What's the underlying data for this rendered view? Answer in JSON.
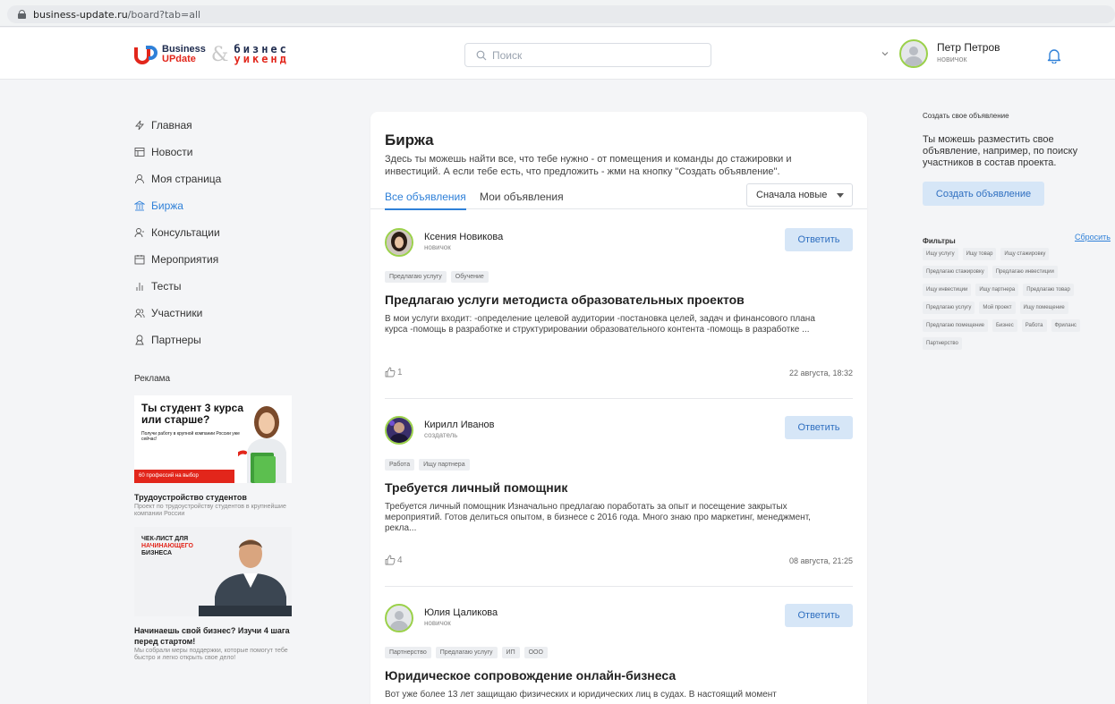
{
  "browser": {
    "domain": "business-update.ru",
    "path": "/board?tab=all"
  },
  "header": {
    "logo": {
      "line1": "Business",
      "line2": "UPdate",
      "amp": "&",
      "word1": "бизнес",
      "word2": "уикенд"
    },
    "search_placeholder": "Поиск",
    "user": {
      "name": "Петр Петров",
      "role": "новичок"
    }
  },
  "nav": [
    {
      "label": "Главная",
      "icon": "lightning-icon"
    },
    {
      "label": "Новости",
      "icon": "newspaper-icon"
    },
    {
      "label": "Моя страница",
      "icon": "user-icon"
    },
    {
      "label": "Биржа",
      "icon": "exchange-icon",
      "active": true
    },
    {
      "label": "Консультации",
      "icon": "consult-icon"
    },
    {
      "label": "Мероприятия",
      "icon": "calendar-icon"
    },
    {
      "label": "Тесты",
      "icon": "chart-icon"
    },
    {
      "label": "Участники",
      "icon": "users-icon"
    },
    {
      "label": "Партнеры",
      "icon": "partner-icon"
    }
  ],
  "ads": {
    "title": "Реклама",
    "ad1": {
      "headline": "Ты студент 3 курса или старше?",
      "text": "Получи работу в крупной компании России уже сейчас!",
      "strip": "60 профессий на выбор",
      "caption": "Трудоустройство студентов",
      "sub": "Проект по трудоустройству студентов в крупнейшие компании России"
    },
    "ad2": {
      "line1": "ЧЕК-ЛИСТ ДЛЯ",
      "line2": "НАЧИНАЮЩЕГО",
      "line3": "БИЗНЕСА",
      "caption": "Начинаешь свой бизнес? Изучи 4 шага перед стартом!",
      "sub": "Мы собрали меры поддержки, которые помогут тебе быстро и легко открыть свое дело!"
    }
  },
  "main": {
    "title": "Биржа",
    "intro": "Здесь ты можешь найти все, что тебе нужно - от помещения и команды до стажировки и инвестиций. А если тебе есть, что предложить - жми на кнопку \"Создать объявление\".",
    "tabs": [
      "Все объявления",
      "Мои объявления"
    ],
    "sort": "Сначала новые",
    "reply_label": "Ответить",
    "posts": [
      {
        "author": "Ксения Новикова",
        "role": "новичок",
        "tags": [
          "Предлагаю услугу",
          "Обучение"
        ],
        "title": "Предлагаю услуги методиста образовательных проектов",
        "text": "В мои услуги входит: -определение целевой аудитории -постановка целей, задач и финансового плана курса -помощь в разработке и структурировании образовательного контента -помощь в разработке ...",
        "likes": "1",
        "date": "22 августа, 18:32"
      },
      {
        "author": "Кирилл Иванов",
        "role": "создатель",
        "tags": [
          "Работа",
          "Ищу партнера"
        ],
        "title": "Требуется личный помощник",
        "text": "Требуется личный помощник Изначально предлагаю поработать за опыт и посещение закрытых мероприятий. Готов делиться опытом, в бизнесе с 2016 года. Много знаю про маркетинг, менеджмент, рекла...",
        "likes": "4",
        "date": "08 августа, 21:25"
      },
      {
        "author": "Юлия Цаликова",
        "role": "новичок",
        "tags": [
          "Партнерство",
          "Предлагаю услугу",
          "ИП",
          "ООО"
        ],
        "title": "Юридическое сопровождение онлайн-бизнеса",
        "text": "Вот уже более 13 лет защищаю физических и юридических лиц в судах. В настоящий момент",
        "likes": "",
        "date": ""
      }
    ]
  },
  "right": {
    "small_title": "Создать свое объявление",
    "desc": "Ты можешь разместить свое объявление, например, по поиску участников в состав проекта.",
    "create_button": "Создать объявление",
    "filters_title": "Фильтры",
    "reset": "Сбросить",
    "filter_tags": [
      "Ищу услугу",
      "Ищу товар",
      "Ищу стажировку",
      "Предлагаю стажировку",
      "Предлагаю инвестиции",
      "Ищу инвестиции",
      "Ищу партнера",
      "Предлагаю товар",
      "Предлагаю услугу",
      "Мой проект",
      "Ищу помещение",
      "Предлагаю помещение",
      "Бизнес",
      "Работа",
      "Фриланс",
      "Партнерство"
    ]
  },
  "colors": {
    "accent": "#2f80d8",
    "button_bg": "#d6e6f7",
    "avatar_ring": "#9bd14a",
    "brand_red": "#e2261b"
  }
}
